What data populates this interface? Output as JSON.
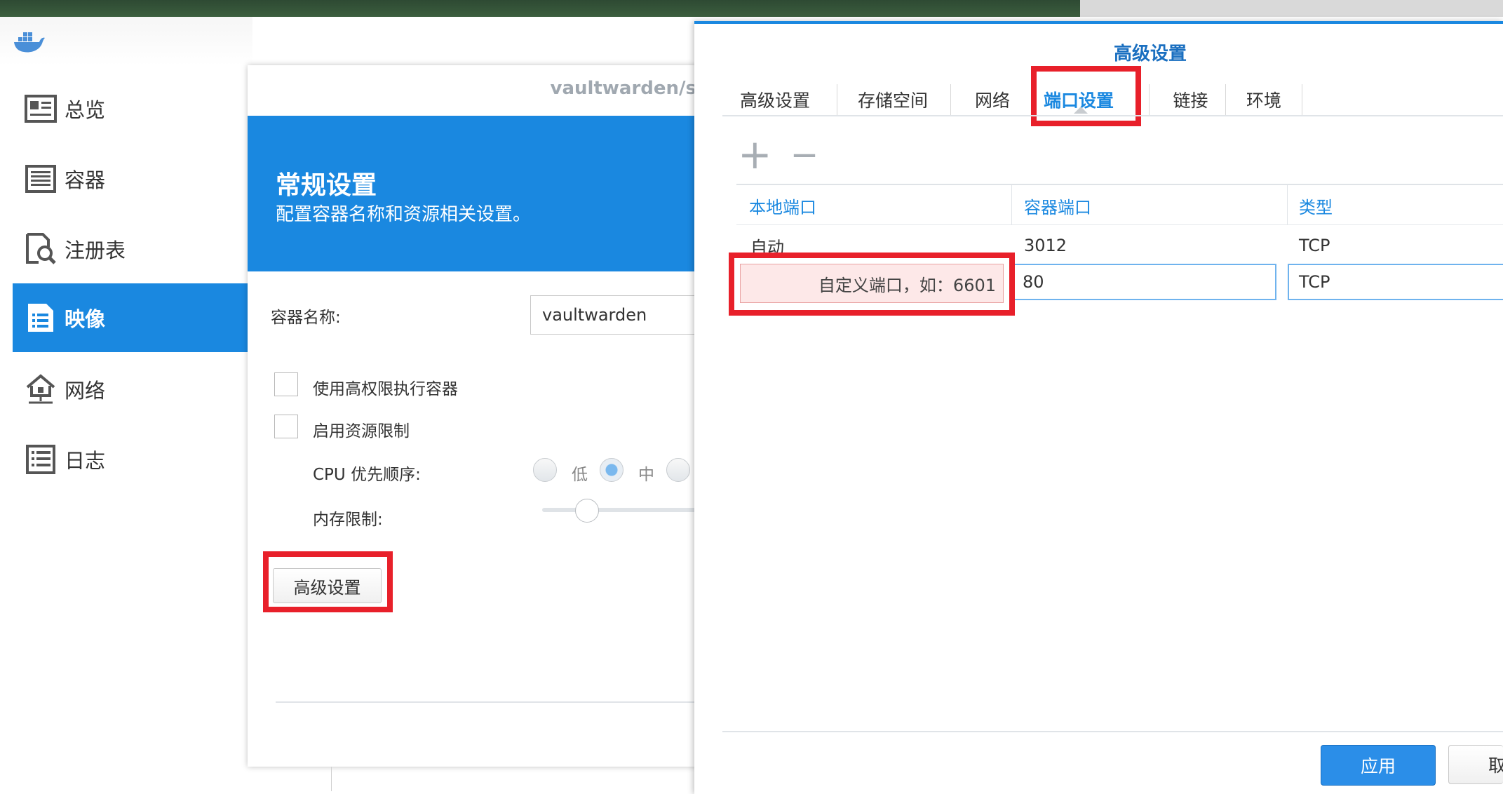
{
  "colors": {
    "accent": "#1a88e0",
    "highlight": "#e8202a"
  },
  "sidebar": {
    "items": [
      {
        "label": "总览",
        "icon": "overview-icon"
      },
      {
        "label": "容器",
        "icon": "container-icon"
      },
      {
        "label": "注册表",
        "icon": "registry-icon"
      },
      {
        "label": "映像",
        "icon": "image-icon",
        "active": true
      },
      {
        "label": "网络",
        "icon": "network-icon"
      },
      {
        "label": "日志",
        "icon": "log-icon"
      }
    ]
  },
  "general_dialog": {
    "title": "vaultwarden/s",
    "banner_title": "常规设置",
    "banner_subtitle": "配置容器名称和资源相关设置。",
    "container_name_label": "容器名称:",
    "container_name_value": "vaultwarden",
    "privileged_label": "使用高权限执行容器",
    "resource_limit_label": "启用资源限制",
    "cpu_priority_label": "CPU 优先顺序:",
    "cpu_low": "低",
    "cpu_mid": "中",
    "memory_limit_label": "内存限制:",
    "advanced_button": "高级设置"
  },
  "advanced_dialog": {
    "title": "高级设置",
    "tabs": [
      "高级设置",
      "存储空间",
      "网络",
      "端口设置",
      "链接",
      "环境"
    ],
    "selected_tab": "端口设置",
    "add_symbol": "+",
    "remove_symbol": "—",
    "columns": [
      "本地端口",
      "容器端口",
      "类型"
    ],
    "rows": [
      {
        "local": "自动",
        "container": "3012",
        "type": "TCP"
      }
    ],
    "edit_row": {
      "local_placeholder": "自定义端口，如：6601",
      "container": "80",
      "type": "TCP"
    },
    "apply_button": "应用",
    "cancel_button": "取消"
  }
}
